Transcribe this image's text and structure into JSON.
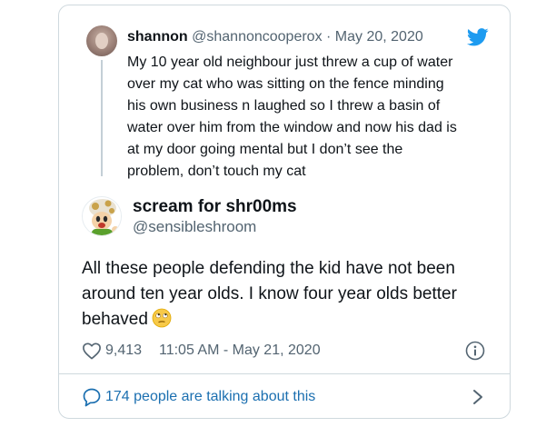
{
  "quoted_tweet": {
    "name": "shannon",
    "handle": "@shannoncooperox",
    "separator": " · ",
    "date": "May 20, 2020",
    "text_lines": [
      "My 10 year old neighbour just threw a cup of water",
      "over my cat who was sitting on the fence minding",
      "his own business n laughed so I threw a basin of",
      "water over him from the window and now his dad is",
      "at my door going mental but I don’t see the",
      "problem, don’t touch my cat"
    ]
  },
  "tweet": {
    "name": "scream for shr00ms",
    "handle": "@sensibleshroom",
    "text_lines": [
      "All these people defending the kid have not been",
      "around ten year olds. I know four year olds better",
      "behaved"
    ],
    "likes": "9,413",
    "timestamp": "11:05 AM - May 21, 2020",
    "talking": "174 people are talking about this"
  },
  "icons": {
    "brand": "twitter-bird-icon",
    "like": "heart-icon",
    "info": "info-icon",
    "chat": "chat-bubble-icon",
    "more": "chevron-right-icon",
    "emoji": "face-with-rolling-eyes"
  },
  "colors": {
    "twitter_blue": "#1d9bf0",
    "link": "#1b6fb0",
    "text": "#0f1419",
    "muted": "#536471",
    "border": "#cfd9de"
  }
}
